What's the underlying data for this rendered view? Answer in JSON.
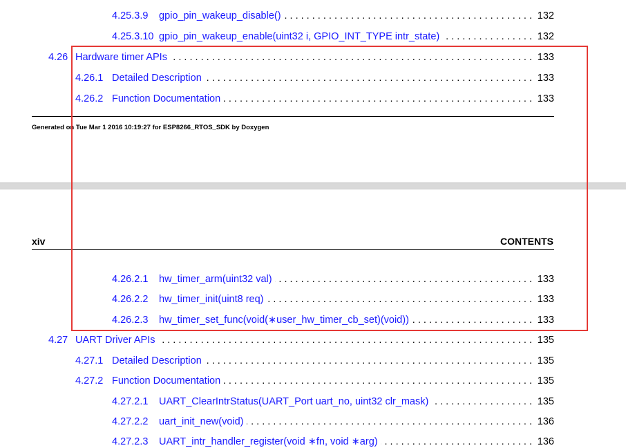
{
  "top_entries": [
    {
      "num": "4.25.3.9",
      "title": "gpio_pin_wakeup_disable()",
      "page": "132"
    },
    {
      "num": "4.25.3.10",
      "title": "gpio_pin_wakeup_enable(uint32 i, GPIO_INT_TYPE intr_state)",
      "page": "132"
    },
    {
      "num": "4.26",
      "title": "Hardware timer APIs",
      "page": "133"
    },
    {
      "num": "4.26.1",
      "title": "Detailed Description",
      "page": "133"
    },
    {
      "num": "4.26.2",
      "title": "Function Documentation",
      "page": "133"
    }
  ],
  "footer": {
    "text": "Generated on Tue Mar 1 2016 10:19:27 for ESP8266_RTOS_SDK by Doxygen"
  },
  "header": {
    "page_label": "xiv",
    "section_label": "CONTENTS"
  },
  "bottom_entries": [
    {
      "num": "4.26.2.1",
      "title": "hw_timer_arm(uint32 val)",
      "page": "133"
    },
    {
      "num": "4.26.2.2",
      "title": "hw_timer_init(uint8 req)",
      "page": "133"
    },
    {
      "num": "4.26.2.3",
      "title": "hw_timer_set_func(void(∗user_hw_timer_cb_set)(void))",
      "page": "133"
    },
    {
      "num": "4.27",
      "title": "UART Driver APIs",
      "page": "135"
    },
    {
      "num": "4.27.1",
      "title": "Detailed Description",
      "page": "135"
    },
    {
      "num": "4.27.2",
      "title": "Function Documentation",
      "page": "135"
    },
    {
      "num": "4.27.2.1",
      "title": "UART_ClearIntrStatus(UART_Port uart_no, uint32 clr_mask)",
      "page": "135"
    },
    {
      "num": "4.27.2.2",
      "title": "uart_init_new(void)",
      "page": "136"
    },
    {
      "num": "4.27.2.3",
      "title": "UART_intr_handler_register(void ∗fn, void ∗arg)",
      "page": "136"
    }
  ],
  "highlight_color": "#e53935",
  "link_color": "#1a1aff"
}
